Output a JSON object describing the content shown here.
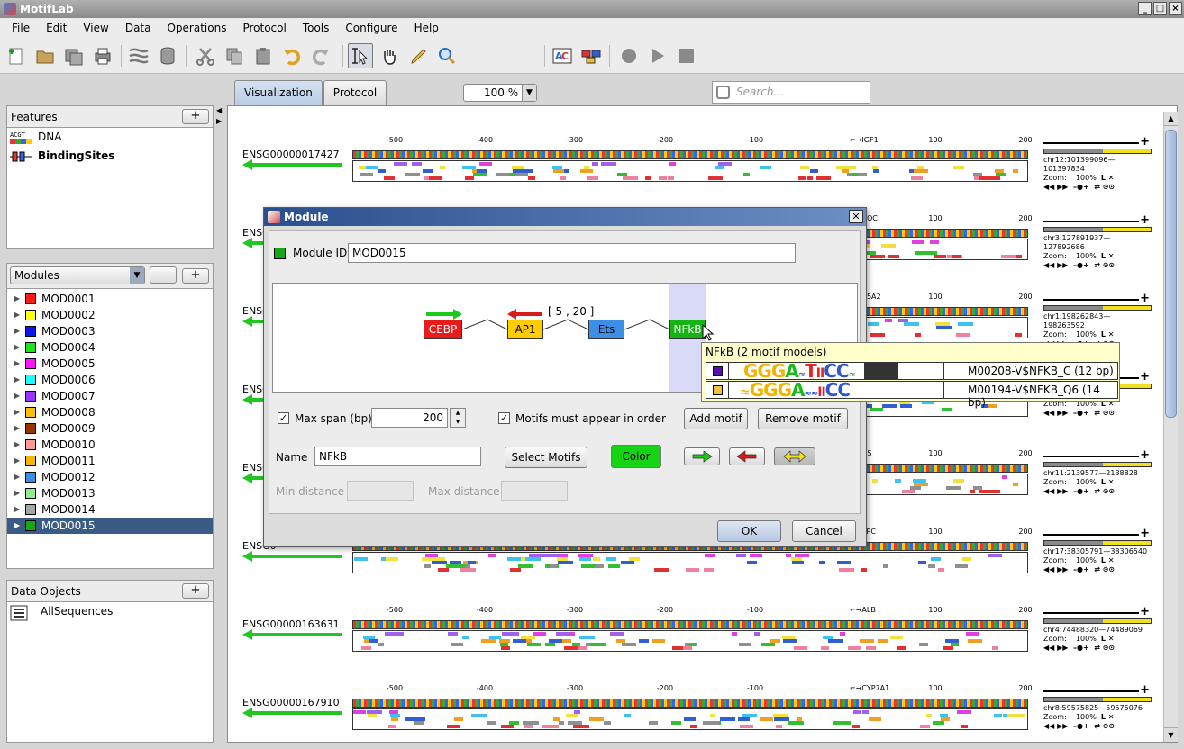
{
  "app": {
    "title": "MotifLab"
  },
  "menu": [
    "File",
    "Edit",
    "View",
    "Data",
    "Operations",
    "Protocol",
    "Tools",
    "Configure",
    "Help"
  ],
  "toolbar": {
    "zoom": "100 %",
    "search_placeholder": "Search..."
  },
  "features": {
    "title": "Features",
    "items": [
      {
        "label": "DNA",
        "icon": "dna-track-icon"
      },
      {
        "label": "BindingSites",
        "icon": "binding-sites-icon"
      }
    ]
  },
  "modules": {
    "combo": "Modules",
    "items": [
      {
        "label": "MOD0001",
        "color": "#ff1a1a"
      },
      {
        "label": "MOD0002",
        "color": "#ffff00"
      },
      {
        "label": "MOD0003",
        "color": "#0a16f0"
      },
      {
        "label": "MOD0004",
        "color": "#17e617"
      },
      {
        "label": "MOD0005",
        "color": "#ff14ff"
      },
      {
        "label": "MOD0006",
        "color": "#14ffff"
      },
      {
        "label": "MOD0007",
        "color": "#9c33ff"
      },
      {
        "label": "MOD0008",
        "color": "#ffbf00"
      },
      {
        "label": "MOD0009",
        "color": "#993300"
      },
      {
        "label": "MOD0010",
        "color": "#ff9999"
      },
      {
        "label": "MOD0011",
        "color": "#f5b800"
      },
      {
        "label": "MOD0012",
        "color": "#3a8ee6"
      },
      {
        "label": "MOD0013",
        "color": "#8cf08c"
      },
      {
        "label": "MOD0014",
        "color": "#a6a6a6"
      },
      {
        "label": "MOD0015",
        "color": "#14a814"
      }
    ],
    "selected": 14
  },
  "data_objects": {
    "title": "Data Objects",
    "items": [
      {
        "label": "AllSequences"
      }
    ]
  },
  "tabs": [
    {
      "label": "Visualization",
      "active": true
    },
    {
      "label": "Protocol",
      "active": false
    }
  ],
  "ruler_ticks": [
    "-500",
    "-400",
    "-300",
    "-200",
    "-100",
    "100",
    "200"
  ],
  "sequences": [
    {
      "name": "ENSG00000017427",
      "tss": "IGF1",
      "region": "chr12:101399096—101397834",
      "zoom": "100%"
    },
    {
      "name": "ENSG0",
      "tss": "ROC",
      "region": "chr3:127891937—127892686",
      "zoom": "100%"
    },
    {
      "name": "ENSG0",
      "tss": "R5A2",
      "region": "chr1:198262843—198263592",
      "zoom": "100%"
    },
    {
      "name": "ENSG0",
      "tss": "",
      "region": "226037",
      "zoom": "100%"
    },
    {
      "name": "ENSG0",
      "tss": "NS",
      "region": "chr11:2139577—2138828",
      "zoom": "100%"
    },
    {
      "name": "ENSG0",
      "tss": "8PC",
      "region": "chr17:38305791—38306540",
      "zoom": "100%"
    },
    {
      "name": "ENSG00000163631",
      "tss": "ALB",
      "region": "chr4:74488320—74489069",
      "zoom": "100%"
    },
    {
      "name": "ENSG00000167910",
      "tss": "CYP7A1",
      "region": "chr8:59575825—59575076",
      "zoom": "100%"
    }
  ],
  "track_labels": {
    "zoom": "Zoom:"
  },
  "dialog": {
    "title": "Module",
    "module_id_label": "Module ID",
    "module_id": "MOD0015",
    "diagram": {
      "motifs": [
        {
          "label": "CEBP",
          "color": "#e81c1c",
          "text_color": "#ffffff",
          "orientation": "forward"
        },
        {
          "label": "AP1",
          "color": "#ffcc00",
          "text_color": "#000000",
          "orientation": "reverse"
        },
        {
          "label": "Ets",
          "color": "#3c8fe6",
          "text_color": "#000000",
          "orientation": "none"
        },
        {
          "label": "NFkB",
          "color": "#14b414",
          "text_color": "#ffffff",
          "orientation": "none"
        }
      ],
      "distance_label": "[ 5 , 20 ]"
    },
    "max_span_label": "Max span (bp)",
    "max_span": "200",
    "order_label": "Motifs must appear in order",
    "add_motif": "Add motif",
    "remove_motif": "Remove motif",
    "name_label": "Name",
    "name_value": "NFkB",
    "select_motifs": "Select Motifs",
    "color_btn": "Color",
    "min_distance_label": "Min distance",
    "max_distance_label": "Max distance",
    "ok": "OK",
    "cancel": "Cancel"
  },
  "tooltip": {
    "title": "NFkB (2 motif models)",
    "models": [
      {
        "name": "M00208-V$NFKB_C  (12 bp)",
        "color": "#5a0fa8",
        "logo": "GGGA≈TIICC≈"
      },
      {
        "name": "M00194-V$NFKB_Q6  (14 bp)",
        "color": "#f0c040",
        "logo": "≈GGGA≈≈IICC"
      }
    ]
  }
}
